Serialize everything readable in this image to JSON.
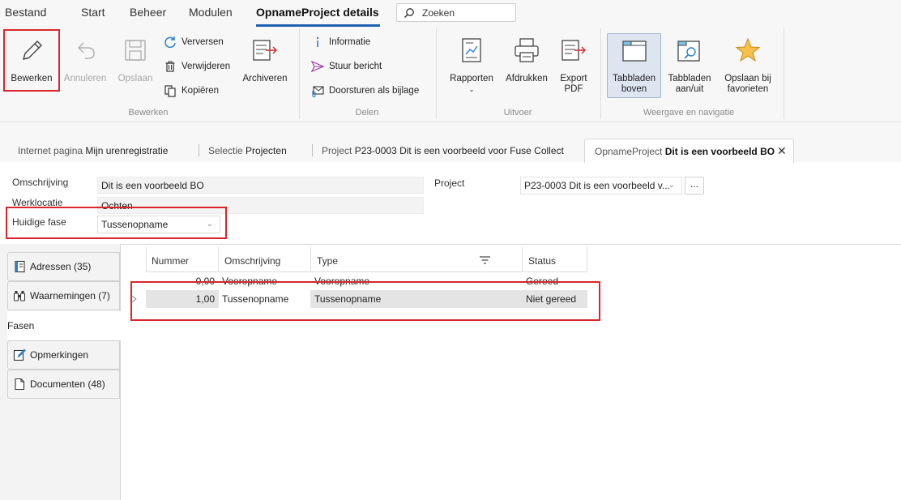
{
  "menu": {
    "items": [
      "Bestand",
      "Start",
      "Beheer",
      "Modulen",
      "OpnameProject details"
    ],
    "search_label": "Zoeken"
  },
  "ribbon": {
    "bewerken_group": {
      "label": "Bewerken",
      "edit": "Bewerken",
      "cancel": "Annuleren",
      "save": "Opslaan",
      "refresh": "Verversen",
      "delete": "Verwijderen",
      "copy": "Kopiëren",
      "archive": "Archiveren"
    },
    "delen_group": {
      "label": "Delen",
      "info": "Informatie",
      "send_message": "Stuur bericht",
      "forward_attachment": "Doorsturen als bijlage"
    },
    "uitvoer_group": {
      "label": "Uitvoer",
      "reports": "Rapporten",
      "print": "Afdrukken",
      "export_pdf_1": "Export",
      "export_pdf_2": "PDF"
    },
    "weergave_group": {
      "label": "Weergave en navigatie",
      "tabs_top_1": "Tabbladen",
      "tabs_top_2": "boven",
      "tabs_toggle_1": "Tabbladen",
      "tabs_toggle_2": "aan/uit",
      "favorites_1": "Opslaan bij",
      "favorites_2": "favorieten"
    }
  },
  "doc_tabs": [
    {
      "prefix": "Internet pagina",
      "name": "Mijn urenregistratie"
    },
    {
      "prefix": "Selectie",
      "name": "Projecten"
    },
    {
      "prefix": "Project",
      "name": "P23-0003 Dit is een voorbeeld voor Fuse Collect"
    },
    {
      "prefix": "OpnameProject",
      "name": "Dit is een voorbeeld BO",
      "close": "✕"
    }
  ],
  "form": {
    "omschrijving_label": "Omschrijving",
    "omschrijving_value": "Dit is een voorbeeld BO",
    "werklocatie_label": "Werklocatie",
    "werklocatie_value": "Ochten",
    "fase_label": "Huidige fase",
    "fase_value": "Tussenopname",
    "project_label": "Project",
    "project_value": "P23-0003 Dit is een voorbeeld v...",
    "dots": "..."
  },
  "side_tabs": [
    {
      "label": "Adressen (35)",
      "icon": "address-book-icon"
    },
    {
      "label": "Waarnemingen (7)",
      "icon": "binoculars-icon"
    },
    {
      "label": "Fasen",
      "icon": ""
    },
    {
      "label": "Opmerkingen",
      "icon": "note-edit-icon"
    },
    {
      "label": "Documenten (48)",
      "icon": "document-icon"
    }
  ],
  "grid": {
    "columns": [
      "Nummer",
      "Omschrijving",
      "Type",
      "Status"
    ],
    "rows": [
      {
        "nummer": "0,00",
        "omschrijving": "Vooropname",
        "type": "Vooropname",
        "status": "Gereed"
      },
      {
        "nummer": "1,00",
        "omschrijving": "Tussenopname",
        "type": "Tussenopname",
        "status": "Niet gereed"
      }
    ]
  },
  "colors": {
    "accent": "#1f5fb4",
    "highlight_box": "#d9262c",
    "selected_row": "#e4e4e4"
  }
}
